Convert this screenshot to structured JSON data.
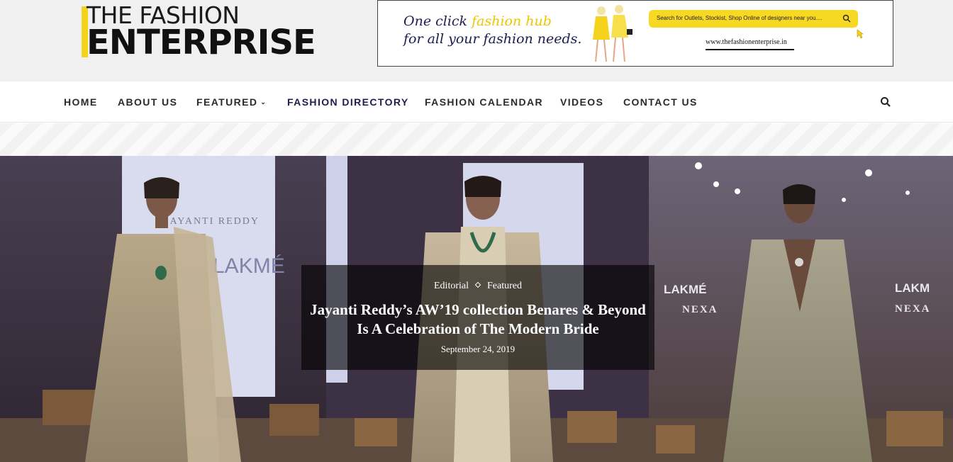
{
  "logo": {
    "line1": "THE FASHION",
    "line2": "ENTERPRISE"
  },
  "banner": {
    "tagline_pre": "One click ",
    "tagline_highlight": "fashion hub",
    "tagline_line2": "for all your fashion needs.",
    "search_placeholder": "Search for Outlets, Stockist, Shop Online of designers near you....",
    "url": "www.thefashionenterprise.in"
  },
  "nav": {
    "items": [
      {
        "label": "HOME"
      },
      {
        "label": "ABOUT US"
      },
      {
        "label": "FEATURED"
      },
      {
        "label": "FASHION DIRECTORY"
      },
      {
        "label": "FASHION CALENDAR"
      },
      {
        "label": "VIDEOS"
      },
      {
        "label": "CONTACT US"
      }
    ]
  },
  "hero": {
    "category_1": "Editorial",
    "category_2": "Featured",
    "title": "Jayanti Reddy’s AW’19 collection Benares & Beyond Is A Celebration of The Modern Bride",
    "date": "September 24, 2019",
    "backdrop_text": {
      "brand_left": "JAYANTI REDDY",
      "lakme": "LAKMÉ",
      "nexa": "NEXA",
      "lakme_right": "LAKM"
    }
  },
  "colors": {
    "accent_yellow": "#f5d21b",
    "nav_active": "#1b1f4a",
    "header_bg": "#eff0ef"
  }
}
